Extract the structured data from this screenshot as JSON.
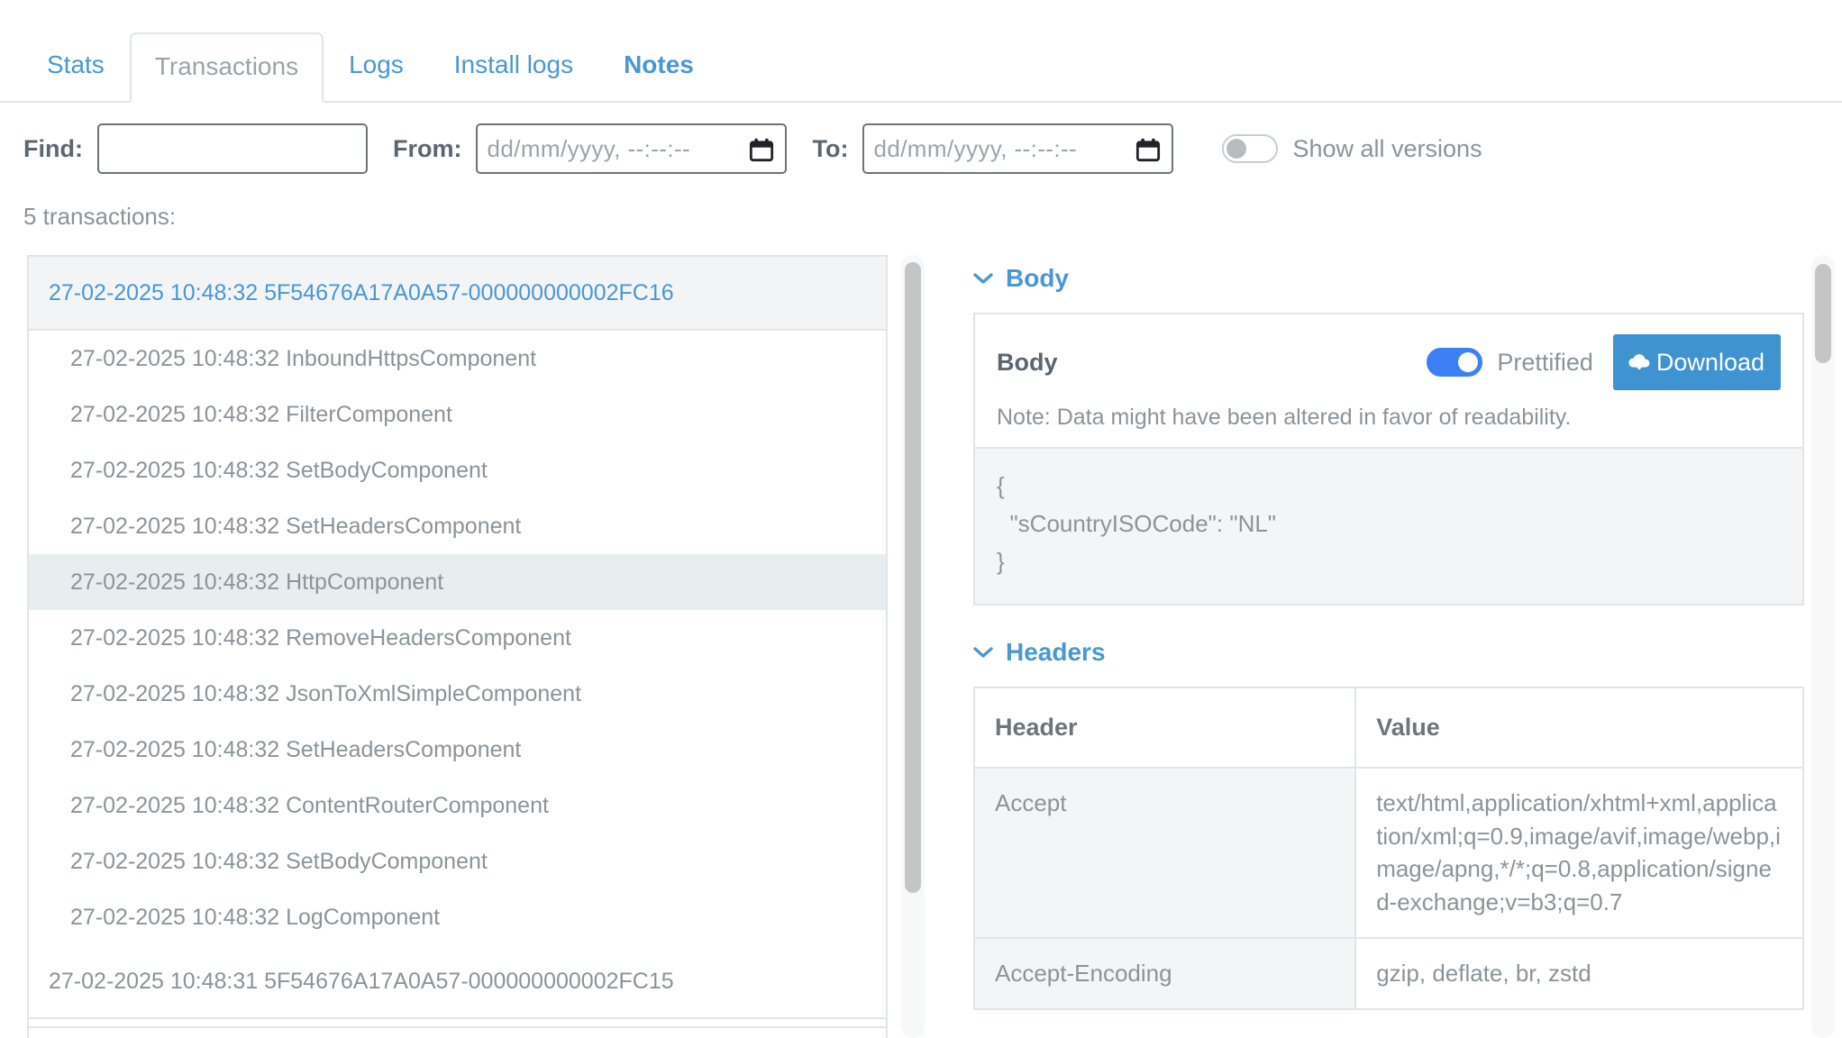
{
  "tabs": [
    {
      "label": "Stats",
      "state": "link"
    },
    {
      "label": "Transactions",
      "state": "active"
    },
    {
      "label": "Logs",
      "state": "link"
    },
    {
      "label": "Install logs",
      "state": "link"
    },
    {
      "label": "Notes",
      "state": "bold"
    }
  ],
  "filter": {
    "find_label": "Find:",
    "find_value": "",
    "find_placeholder": "",
    "from_label": "From:",
    "from_value": "",
    "from_placeholder": "dd/mm/yyyy, --:--:--",
    "to_label": "To:",
    "to_value": "",
    "to_placeholder": "dd/mm/yyyy, --:--:--",
    "show_all_versions_label": "Show all versions",
    "show_all_versions_on": false
  },
  "list": {
    "count_label": "5 transactions:",
    "groups": [
      {
        "header": "27-02-2025 10:48:32 5F54676A17A0A57-000000000002FC16",
        "open": true,
        "rows": [
          {
            "label": "27-02-2025 10:48:32 InboundHttpsComponent",
            "selected": false
          },
          {
            "label": "27-02-2025 10:48:32 FilterComponent",
            "selected": false
          },
          {
            "label": "27-02-2025 10:48:32 SetBodyComponent",
            "selected": false
          },
          {
            "label": "27-02-2025 10:48:32 SetHeadersComponent",
            "selected": false
          },
          {
            "label": "27-02-2025 10:48:32 HttpComponent",
            "selected": true
          },
          {
            "label": "27-02-2025 10:48:32 RemoveHeadersComponent",
            "selected": false
          },
          {
            "label": "27-02-2025 10:48:32 JsonToXmlSimpleComponent",
            "selected": false
          },
          {
            "label": "27-02-2025 10:48:32 SetHeadersComponent",
            "selected": false
          },
          {
            "label": "27-02-2025 10:48:32 ContentRouterComponent",
            "selected": false
          },
          {
            "label": "27-02-2025 10:48:32 SetBodyComponent",
            "selected": false
          },
          {
            "label": "27-02-2025 10:48:32 LogComponent",
            "selected": false
          }
        ]
      },
      {
        "header": "27-02-2025 10:48:31 5F54676A17A0A57-000000000002FC15",
        "open": false,
        "rows": []
      },
      {
        "header": "",
        "open": false,
        "rows": []
      }
    ]
  },
  "detail": {
    "body_section": {
      "title": "Body",
      "card_title": "Body",
      "prettified_label": "Prettified",
      "prettified_on": true,
      "download_label": "Download",
      "note": "Note: Data might have been altered in favor of readability.",
      "content": "{\n  \"sCountryISOCode\": \"NL\"\n}"
    },
    "headers_section": {
      "title": "Headers",
      "columns": [
        "Header",
        "Value"
      ],
      "rows": [
        {
          "header": "Accept",
          "value": "text/html,application/xhtml+xml,application/xml;q=0.9,image/avif,image/webp,image/apng,*/*;q=0.8,application/signed-exchange;v=b3;q=0.7"
        },
        {
          "header": "Accept-Encoding",
          "value": "gzip, deflate, br, zstd"
        }
      ]
    }
  },
  "colors": {
    "link_blue": "#4a97d2",
    "toggle_blue": "#3f7ff5",
    "button_blue": "#3f93d1",
    "text_grey": "#8b949a",
    "border_grey": "#e2e5e7",
    "selected_row": "#e8eef0"
  }
}
